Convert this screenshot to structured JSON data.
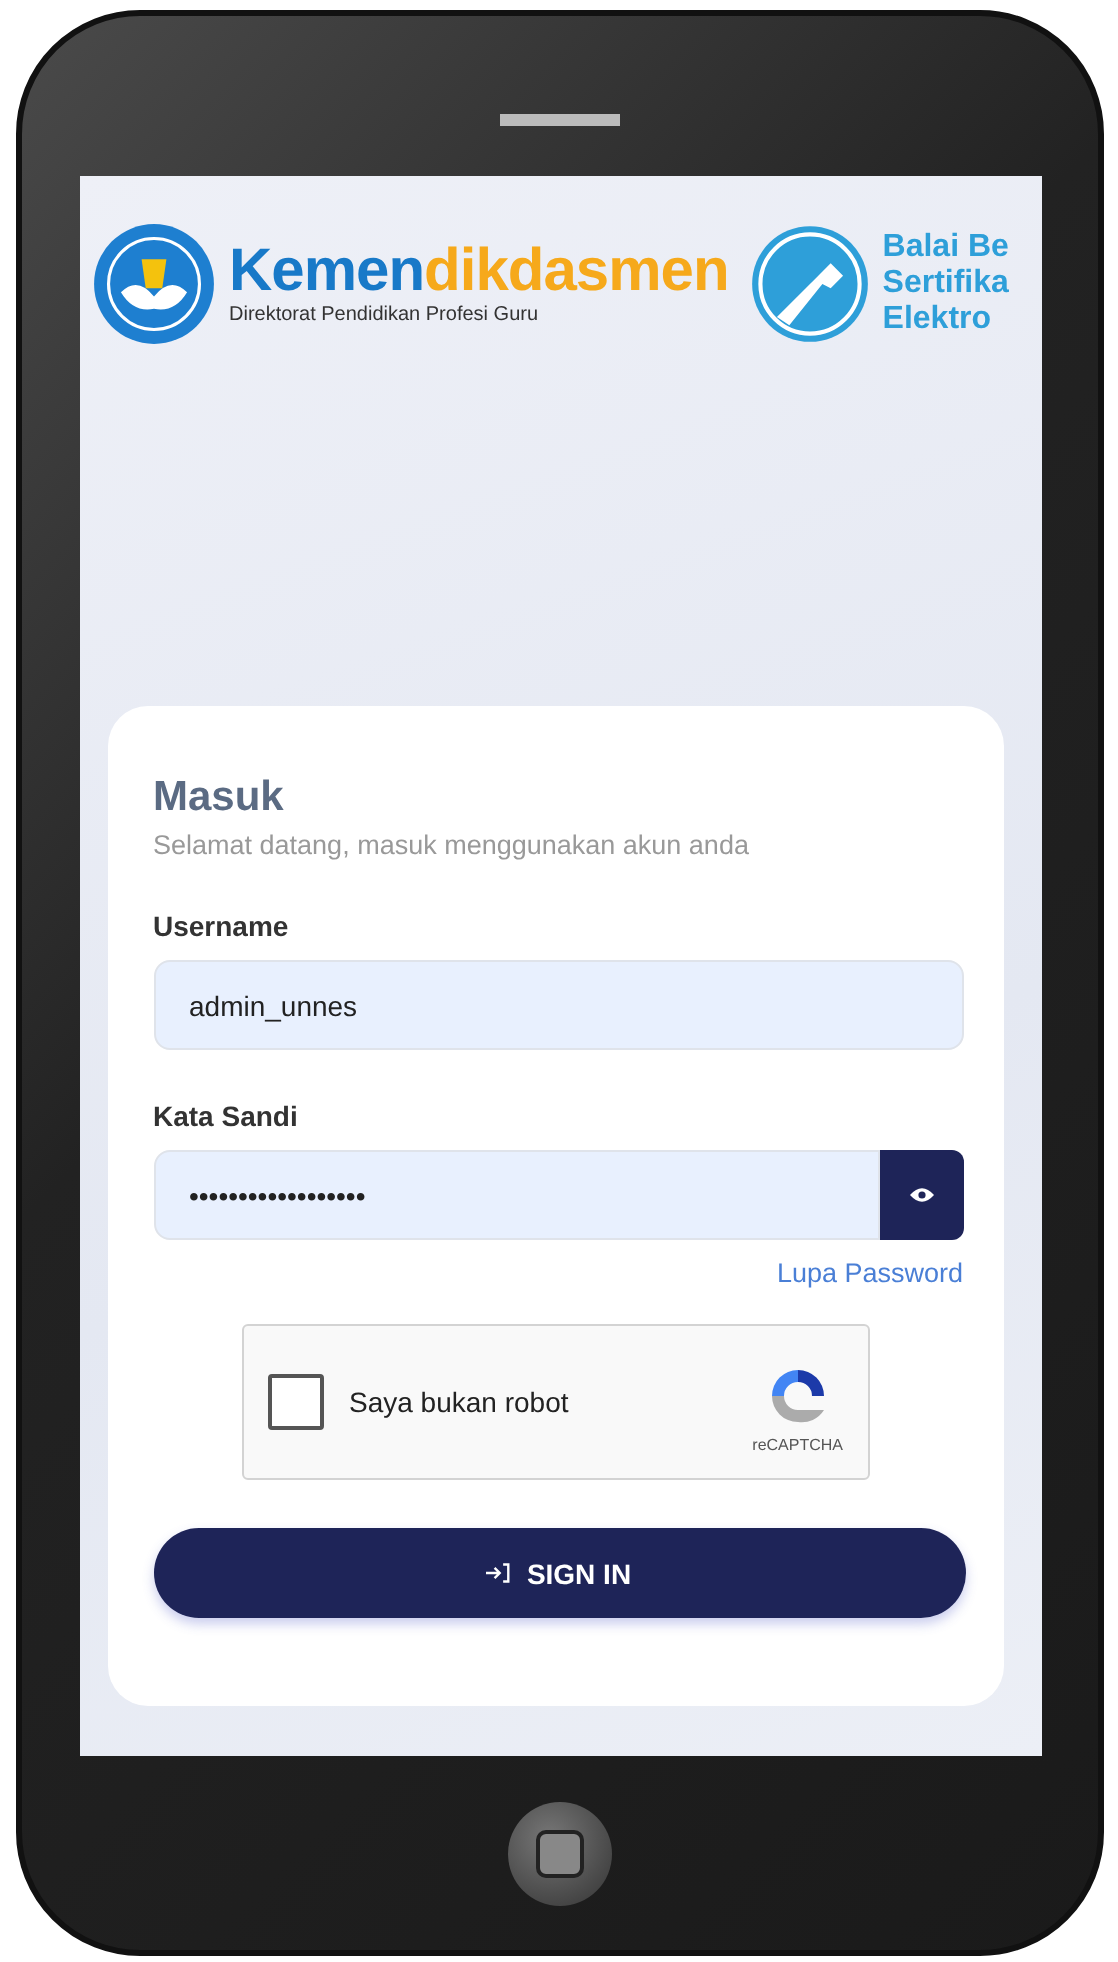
{
  "header": {
    "brand_primary": "Kemen",
    "brand_accent": "dikdasmen",
    "brand_subtitle": "Direktorat Pendidikan Profesi Guru",
    "partner_lines": [
      "Balai Be",
      "Sertifika",
      "Elektro"
    ]
  },
  "login": {
    "title": "Masuk",
    "subtitle": "Selamat datang, masuk menggunakan akun anda",
    "fields": [
      {
        "kind": "text",
        "label": "Username",
        "value": "admin_unnes"
      },
      {
        "kind": "password",
        "label": "Kata Sandi",
        "value": "••••••••••••••••••"
      }
    ],
    "forgot_link": "Lupa Password",
    "captcha": {
      "label": "Saya bukan robot",
      "checked": false,
      "brand": "reCAPTCHA"
    },
    "submit": "SIGN IN"
  }
}
